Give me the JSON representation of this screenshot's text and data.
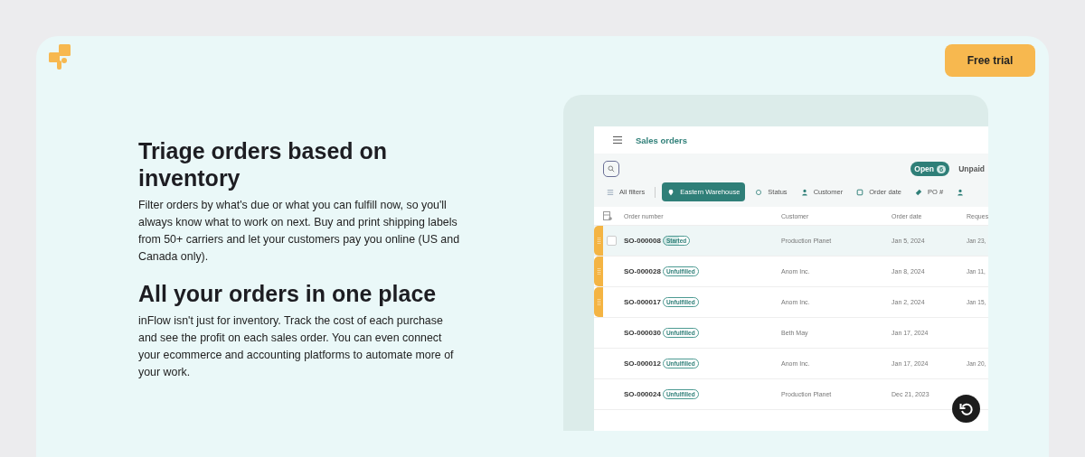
{
  "header": {
    "free_trial": "Free trial"
  },
  "sections": [
    {
      "heading": "Triage orders based on inventory",
      "body": "Filter orders by what's due or what you can fulfill now, so you'll always know what to work on next. Buy and print shipping labels from 50+ carriers and let your customers pay you online (US and Canada only)."
    },
    {
      "heading": "All your orders in one place",
      "body": "inFlow isn't just for inventory. Track the cost of each purchase and see the profit on each sales order. You can even connect your ecommerce and accounting platforms to automate more of your work."
    }
  ],
  "app": {
    "title": "Sales orders",
    "toggles": [
      {
        "label": "Open",
        "count": "6",
        "selected": true
      },
      {
        "label": "Unpaid",
        "selected": false
      }
    ],
    "filters": [
      {
        "kind": "all",
        "label": "All filters",
        "selected": false
      },
      {
        "kind": "location",
        "label": "Eastern Warehouse",
        "selected": true
      },
      {
        "kind": "status",
        "label": "Status",
        "selected": false
      },
      {
        "kind": "customer",
        "label": "Customer",
        "selected": false
      },
      {
        "kind": "date",
        "label": "Order date",
        "selected": false
      },
      {
        "kind": "po",
        "label": "PO #",
        "selected": false
      },
      {
        "kind": "customer",
        "selected": false
      }
    ],
    "columns": [
      "Order number",
      "Customer",
      "Order date",
      "Reques"
    ],
    "rows": [
      {
        "number": "SO-000008",
        "status": "Started",
        "kind": "started",
        "customer": "Production Planet",
        "order_date": "Jan 5, 2024",
        "request_date": "Jan 23,",
        "dragging": true,
        "hovered": true,
        "checked": false
      },
      {
        "number": "SO-000028",
        "status": "Unfulfilled",
        "kind": "unfulfilled",
        "customer": "Anom Inc.",
        "order_date": "Jan 8, 2024",
        "request_date": "Jan 11,",
        "dragging": true,
        "hovered": false
      },
      {
        "number": "SO-000017",
        "status": "Unfulfilled",
        "kind": "unfulfilled",
        "customer": "Anom Inc.",
        "order_date": "Jan 2, 2024",
        "request_date": "Jan 15,",
        "dragging": true,
        "hovered": false
      },
      {
        "number": "SO-000030",
        "status": "Unfulfilled",
        "kind": "unfulfilled",
        "customer": "Beth May",
        "order_date": "Jan 17, 2024",
        "dragging": false,
        "hovered": false
      },
      {
        "number": "SO-000012",
        "status": "Unfulfilled",
        "kind": "unfulfilled",
        "customer": "Anom Inc.",
        "order_date": "Jan 17, 2024",
        "request_date": "Jan 20,",
        "dragging": false,
        "hovered": false
      },
      {
        "number": "SO-000024",
        "status": "Unfulfilled",
        "kind": "unfulfilled",
        "customer": "Production Planet",
        "order_date": "Dec 21, 2023",
        "dragging": false,
        "hovered": false
      }
    ]
  }
}
